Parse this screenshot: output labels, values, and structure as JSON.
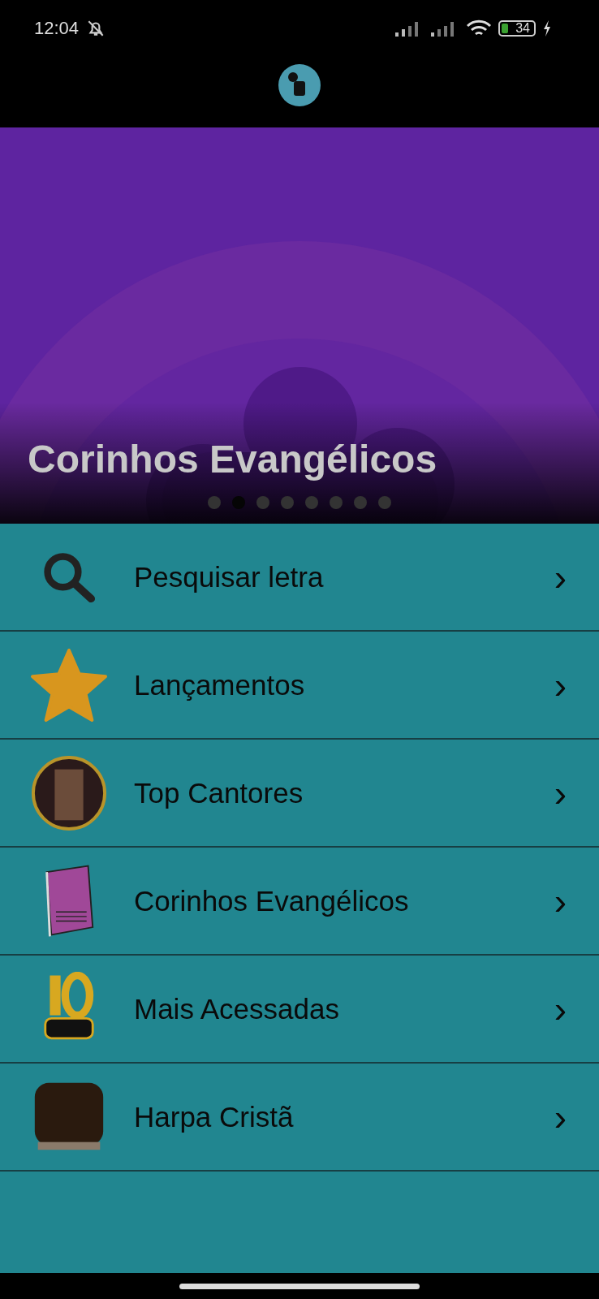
{
  "status_bar": {
    "time": "12:04",
    "battery": "34"
  },
  "banner": {
    "title": "Corinhos Evangélicos",
    "dots": [
      {
        "selected": false
      },
      {
        "selected": true
      },
      {
        "selected": false
      },
      {
        "selected": false
      },
      {
        "selected": false
      },
      {
        "selected": false
      },
      {
        "selected": false
      },
      {
        "selected": false
      }
    ]
  },
  "menu": [
    {
      "kind": "search",
      "label": "Pesquisar letra",
      "chevron": "›"
    },
    {
      "kind": "star",
      "label": "Lançamentos",
      "chevron": "›"
    },
    {
      "kind": "singers",
      "label": "Top Cantores",
      "chevron": "›"
    },
    {
      "kind": "songbook",
      "label": "Corinhos Evangélicos",
      "chevron": "›"
    },
    {
      "kind": "top10",
      "label": "Mais Acessadas",
      "chevron": "›"
    },
    {
      "kind": "hymnal",
      "label": "Harpa Cristã",
      "chevron": "›"
    }
  ]
}
